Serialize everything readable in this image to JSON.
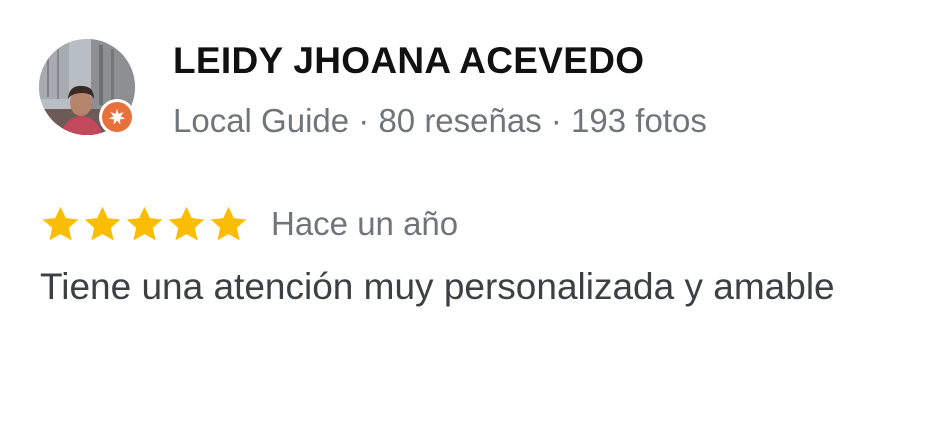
{
  "reviewer": {
    "name": "LEIDY JHOANA ACEVEDO",
    "meta": "Local Guide · 80 reseñas · 193 fotos",
    "avatar_icon": "user-photo",
    "badge_icon": "local-guide-star-badge"
  },
  "review": {
    "rating": 5,
    "rating_max": 5,
    "star_icon": "star-icon",
    "time": "Hace un año",
    "text": "Tiene una atención muy personalizada y amable"
  },
  "colors": {
    "star": "#fbbc04",
    "badge": "#e8703a",
    "name": "#111111",
    "secondary_text": "#70757a",
    "body_text": "#3c4043"
  }
}
